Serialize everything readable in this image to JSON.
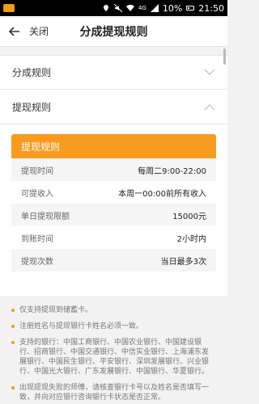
{
  "status_bar": {
    "battery": "10%",
    "time": "21:50",
    "network": "4G"
  },
  "header": {
    "close_label": "关闭",
    "title": "分成提现规则"
  },
  "sections": [
    {
      "label": "分成规则",
      "state": "collapsed"
    },
    {
      "label": "提现规则",
      "state": "expanded"
    }
  ],
  "card": {
    "title": "提现规则",
    "rows": [
      {
        "key": "提现时间",
        "value": "每周二9:00-22:00"
      },
      {
        "key": "可提收入",
        "value": "本周一00:00前所有收入"
      },
      {
        "key": "单日提现限额",
        "value": "15000元"
      },
      {
        "key": "到账时间",
        "value": "2小时内"
      },
      {
        "key": "提现次数",
        "value": "当日最多3次"
      }
    ]
  },
  "notes": [
    "仅支持提现到储蓄卡。",
    "注册姓名与提现银行卡姓名必须一致。",
    "支持的银行：中国工商银行、中国农业银行、中国建设银行、招商银行、中国交通银行、中信实业银行、上海浦东发展银行、中国民生银行、平安银行、深圳发展银行、兴业银行、中国光大银行、广东发展银行、中国银行、华夏银行。",
    "出现提现失败的师傅，请核查银行卡号以及姓名是否填写一致，并向对应银行咨询银行卡状态是否正常。"
  ],
  "colors": {
    "accent": "#f79a1e",
    "bullet": "#f39c12"
  }
}
